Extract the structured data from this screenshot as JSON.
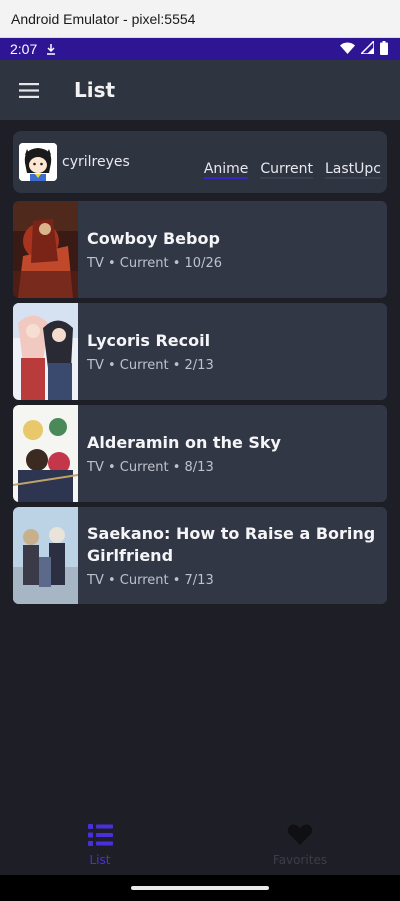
{
  "window": {
    "title": "Android Emulator - pixel:5554"
  },
  "status_bar": {
    "time": "2:07",
    "icons": [
      "download-icon",
      "wifi-icon",
      "signal-icon",
      "battery-icon"
    ]
  },
  "appbar": {
    "title": "List",
    "menu_icon": "hamburger-menu-icon"
  },
  "profile": {
    "username": "cyrilreyes",
    "tabs": [
      {
        "label": "Anime",
        "active": true
      },
      {
        "label": "Current",
        "active": false
      },
      {
        "label": "LastUpc",
        "active": false
      }
    ]
  },
  "items": [
    {
      "title": "Cowboy Bebop",
      "meta": "TV • Current • 10/26"
    },
    {
      "title": "Lycoris Recoil",
      "meta": "TV • Current • 2/13"
    },
    {
      "title": "Alderamin on the Sky",
      "meta": "TV • Current • 8/13"
    },
    {
      "title": "Saekano: How to Raise a Boring Girlfriend",
      "meta": "TV • Current • 7/13"
    }
  ],
  "bottom_nav": [
    {
      "label": "List",
      "icon": "list-icon",
      "active": true
    },
    {
      "label": "Favorites",
      "icon": "heart-icon",
      "active": false
    }
  ],
  "colors": {
    "accent": "#4a2fe0",
    "status_bar": "#2e1594",
    "card": "#323746",
    "background": "#1e1f26"
  }
}
